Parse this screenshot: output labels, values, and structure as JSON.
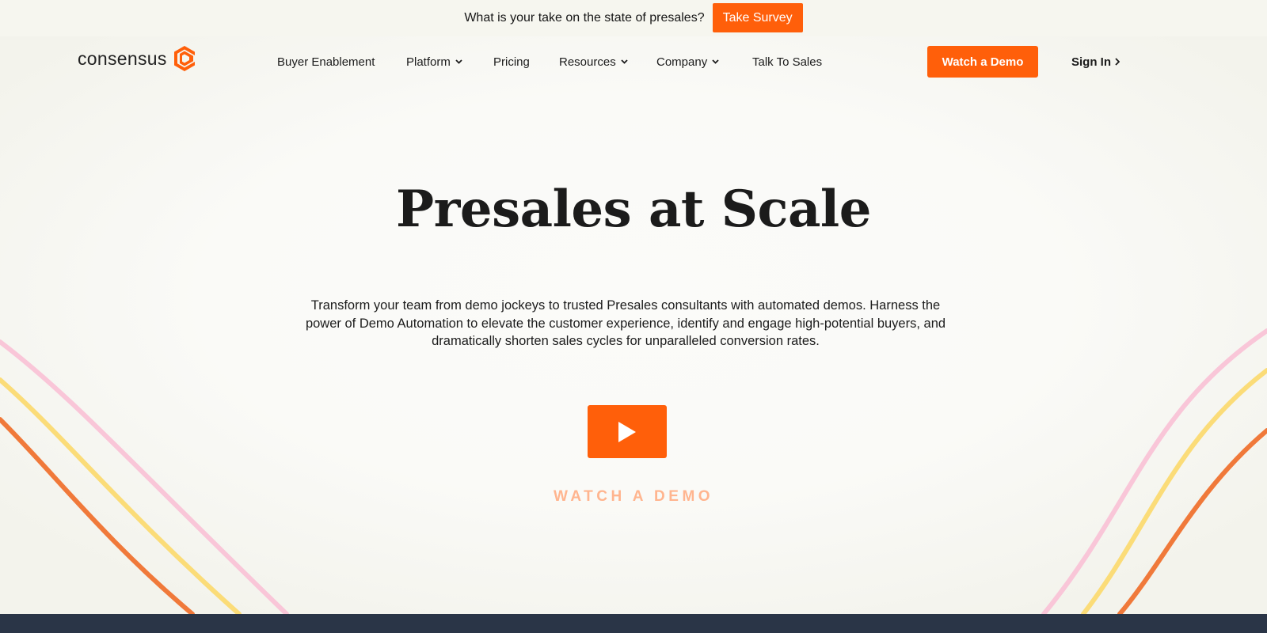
{
  "announcement": {
    "text": "What is your take on the state of presales?",
    "button_label": "Take Survey"
  },
  "header": {
    "logo_text": "consensus",
    "logo_icon": "consensus-c-icon",
    "nav": [
      {
        "label": "Buyer Enablement",
        "has_dropdown": false
      },
      {
        "label": "Platform",
        "has_dropdown": true
      },
      {
        "label": "Pricing",
        "has_dropdown": false
      },
      {
        "label": "Resources",
        "has_dropdown": true
      },
      {
        "label": "Company",
        "has_dropdown": true
      },
      {
        "label": "Talk To Sales",
        "has_dropdown": false
      }
    ],
    "cta_label": "Watch a Demo",
    "signin_label": "Sign In"
  },
  "hero": {
    "title": "Presales at Scale",
    "description": "Transform your team from demo jockeys to trusted Presales consultants with automated demos. Harness the power of Demo Automation to elevate the customer experience, identify and engage high-potential buyers, and dramatically shorten sales cycles for unparalleled conversion rates.",
    "play_icon": "play-icon",
    "watch_label": "WATCH A DEMO"
  },
  "colors": {
    "accent": "#ff5f0a",
    "watch_label": "#ffb58f",
    "footer": "#2a3547",
    "curve_pink": "#f9c6d8",
    "curve_yellow": "#fbdc78",
    "curve_orange": "#f0793a"
  }
}
